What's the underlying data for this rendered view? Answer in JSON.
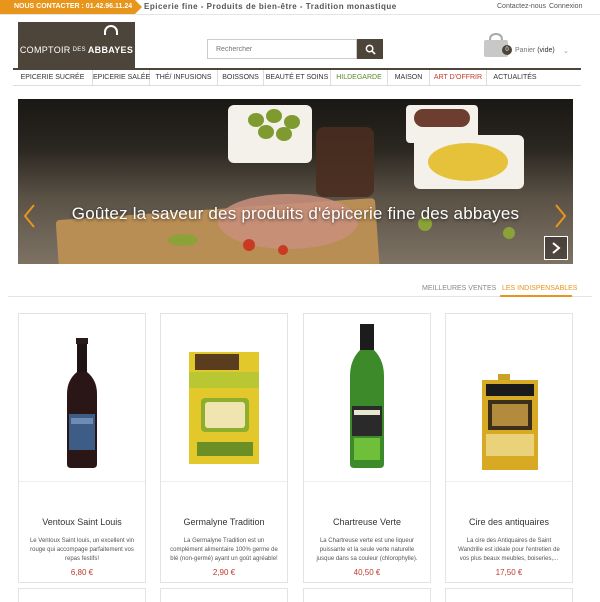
{
  "topbar": {
    "contact_label": "NOUS CONTACTER : 01.42.96.11.24",
    "tagline": "Epicerie fine - Produits de bien-être - Tradition monastique",
    "contact_link": "Contactez-nous",
    "login_link": "Connexion"
  },
  "header": {
    "logo_small": "COMPTOIR",
    "logo_des": "DES",
    "logo_big": "ABBAYES",
    "search_placeholder": "Rechercher",
    "cart_count": "0",
    "cart_label": "Panier",
    "cart_state": "(vide)"
  },
  "nav": {
    "items": [
      {
        "label": "EPICERIE SUCRÉE"
      },
      {
        "label": "EPICERIE SALÉE"
      },
      {
        "label": "THÉ/ INFUSIONS"
      },
      {
        "label": "BOISSONS"
      },
      {
        "label": "BEAUTÉ ET SOINS"
      },
      {
        "label": "HILDEGARDE"
      },
      {
        "label": "MAISON"
      },
      {
        "label": "ART D'OFFRIR"
      },
      {
        "label": "ACTUALITÉS"
      }
    ]
  },
  "hero": {
    "caption": "Goûtez la saveur des produits d'épicerie fine des abbayes"
  },
  "tabs": {
    "best": "MEILLEURES VENTES",
    "indispensables": "LES INDISPENSABLES"
  },
  "products": [
    {
      "name": "Ventoux Saint Louis",
      "desc": "Le Ventoux Saint louis, un excellent vin rouge qui accompage parfaitement vos repas festifs!",
      "price": "6,80 €"
    },
    {
      "name": "Germalyne Tradition",
      "desc": "La Germalyne Tradition est un complément alimentaire 100% germe de blé (non-germé) ayant un goût agréable!",
      "price": "2,90 €"
    },
    {
      "name": "Chartreuse Verte",
      "desc": "La Chartreuse verte est une liqueur puissante et la seule verte naturelle jusque dans sa couleur (chlorophylle).",
      "price": "40,50 €"
    },
    {
      "name": "Cire des antiquaires",
      "desc": "La cire des Antiquaires de Saint Wandrille est idéale pour l'entretien de vos plus beaux meubles, boiseries,...",
      "price": "17,50 €"
    }
  ],
  "colors": {
    "accent": "#e8951b",
    "brand": "#4d443a",
    "price": "#c0392b"
  }
}
